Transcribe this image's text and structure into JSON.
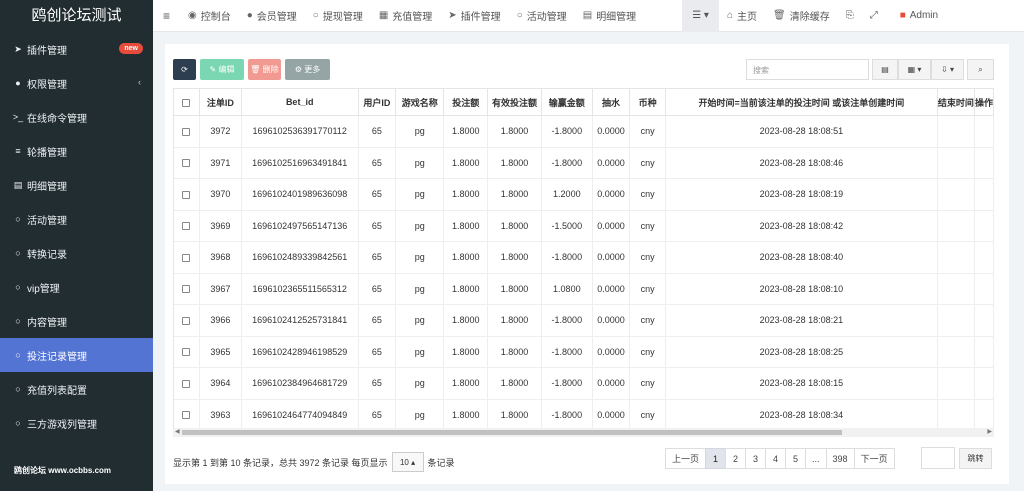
{
  "sidebar": {
    "brand": "鸥创论坛测试",
    "items": [
      {
        "label": "插件管理",
        "icon": "➤",
        "badge": "new"
      },
      {
        "label": "权限管理",
        "icon": "●",
        "caret": "‹"
      },
      {
        "label": "在线命令管理",
        "icon": ">_"
      },
      {
        "label": "轮播管理",
        "icon": "≡"
      },
      {
        "label": "明细管理",
        "icon": "▤"
      },
      {
        "label": "活动管理",
        "icon": "○"
      },
      {
        "label": "转换记录",
        "icon": "○"
      },
      {
        "label": "vip管理",
        "icon": "○"
      },
      {
        "label": "内容管理",
        "icon": "○"
      },
      {
        "label": "投注记录管理",
        "icon": "○",
        "active": true
      },
      {
        "label": "充值列表配置",
        "icon": "○"
      },
      {
        "label": "三方游戏列管理",
        "icon": "○"
      }
    ],
    "footer": "鸥创论坛 www.ocbbs.com"
  },
  "topbar": {
    "menu_icon": "≡",
    "items": [
      {
        "label": "控制台",
        "icon": "◉"
      },
      {
        "label": "会员管理",
        "icon": "●"
      },
      {
        "label": "提现管理",
        "icon": "○"
      },
      {
        "label": "充值管理",
        "icon": "▦"
      },
      {
        "label": "插件管理",
        "icon": "➤"
      },
      {
        "label": "活动管理",
        "icon": "○"
      },
      {
        "label": "明细管理",
        "icon": "▤"
      }
    ],
    "list_icon": "☰ ▾",
    "home": "主页",
    "clear_cache": "清除缓存",
    "admin": "Admin",
    "colors": {
      "accent": "#5374d2",
      "sidebar": "#222d32",
      "admin_icon": "#e74b3c"
    }
  },
  "toolbar": {
    "refresh": "⟳",
    "edit": "✎ 编辑",
    "delete": "🗑 删除",
    "more": "⚙ 更多",
    "search_placeholder": "搜索",
    "col_btn": "▤",
    "grid_btn": "▦ ▾",
    "export_btn": "⇩ ▾",
    "search_btn": "⌕"
  },
  "table": {
    "headers": [
      "注单ID",
      "Bet_id",
      "用户ID",
      "游戏名称",
      "投注额",
      "有效投注额",
      "输赢金额",
      "抽水",
      "币种",
      "开始时间=当前该注单的投注时间 或该注单创建时间",
      "结束时间",
      "操作"
    ],
    "rows": [
      [
        "3972",
        "1696102536391770112",
        "65",
        "pg",
        "1.8000",
        "1.8000",
        "-1.8000",
        "0.0000",
        "cny",
        "2023-08-28 18:08:51"
      ],
      [
        "3971",
        "1696102516963491841",
        "65",
        "pg",
        "1.8000",
        "1.8000",
        "-1.8000",
        "0.0000",
        "cny",
        "2023-08-28 18:08:46"
      ],
      [
        "3970",
        "1696102401989636098",
        "65",
        "pg",
        "1.8000",
        "1.8000",
        "1.2000",
        "0.0000",
        "cny",
        "2023-08-28 18:08:19"
      ],
      [
        "3969",
        "1696102497565147136",
        "65",
        "pg",
        "1.8000",
        "1.8000",
        "-1.5000",
        "0.0000",
        "cny",
        "2023-08-28 18:08:42"
      ],
      [
        "3968",
        "1696102489339842561",
        "65",
        "pg",
        "1.8000",
        "1.8000",
        "-1.8000",
        "0.0000",
        "cny",
        "2023-08-28 18:08:40"
      ],
      [
        "3967",
        "1696102365511565312",
        "65",
        "pg",
        "1.8000",
        "1.8000",
        "1.0800",
        "0.0000",
        "cny",
        "2023-08-28 18:08:10"
      ],
      [
        "3966",
        "1696102412525731841",
        "65",
        "pg",
        "1.8000",
        "1.8000",
        "-1.8000",
        "0.0000",
        "cny",
        "2023-08-28 18:08:21"
      ],
      [
        "3965",
        "1696102428946198529",
        "65",
        "pg",
        "1.8000",
        "1.8000",
        "-1.8000",
        "0.0000",
        "cny",
        "2023-08-28 18:08:25"
      ],
      [
        "3964",
        "1696102384964681729",
        "65",
        "pg",
        "1.8000",
        "1.8000",
        "-1.8000",
        "0.0000",
        "cny",
        "2023-08-28 18:08:15"
      ],
      [
        "3963",
        "1696102464774094849",
        "65",
        "pg",
        "1.8000",
        "1.8000",
        "-1.8000",
        "0.0000",
        "cny",
        "2023-08-28 18:08:34"
      ]
    ]
  },
  "pagination": {
    "info": "显示第 1 到第 10 条记录，总共 3972 条记录 每页显示",
    "page_size": "10 ▴",
    "suffix": "条记录",
    "prev": "上一页",
    "pages": [
      "1",
      "2",
      "3",
      "4",
      "5",
      "...",
      "398"
    ],
    "next": "下一页",
    "jump": "跳转"
  }
}
